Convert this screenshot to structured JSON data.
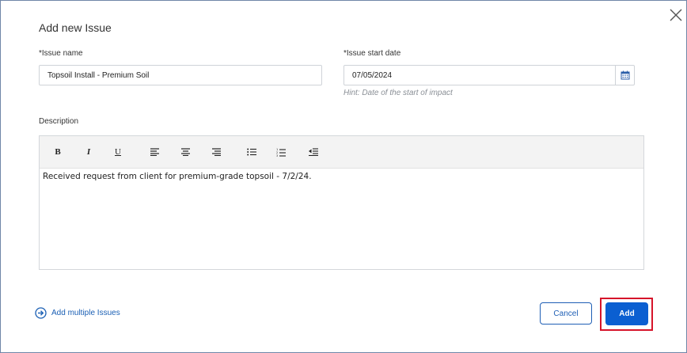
{
  "dialog": {
    "title": "Add new Issue",
    "close_icon": "close-icon"
  },
  "form": {
    "issue_name_label": "*Issue name",
    "issue_name_value": "Topsoil Install - Premium Soil",
    "start_date_label": "*Issue start date",
    "start_date_value": "07/05/2024",
    "start_date_hint": "Hint: Date of the start of impact",
    "calendar_icon": "calendar-icon",
    "description_label": "Description"
  },
  "editor": {
    "toolbar": {
      "bold": "B",
      "italic": "I",
      "underline": "U",
      "icons": [
        "align-left-icon",
        "align-center-icon",
        "align-right-icon",
        "bullet-list-icon",
        "numbered-list-icon",
        "outdent-icon"
      ]
    },
    "content": "Received request from client for premium-grade topsoil - 7/2/24."
  },
  "footer": {
    "add_multiple_label": "Add multiple Issues",
    "add_multiple_icon": "arrow-circle-right-icon",
    "cancel_label": "Cancel",
    "add_label": "Add"
  },
  "colors": {
    "accent": "#0b5fd1",
    "link": "#1a5fb4",
    "highlight": "#d6142a"
  }
}
